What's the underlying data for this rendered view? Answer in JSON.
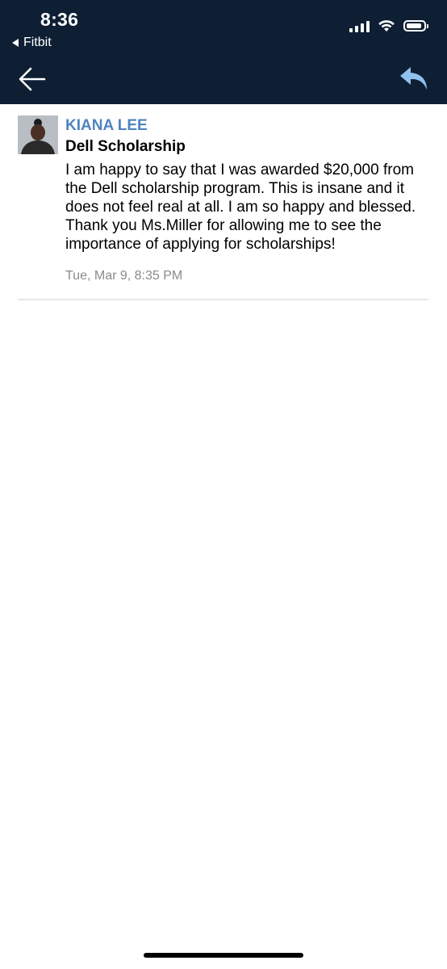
{
  "status_bar": {
    "time": "8:36",
    "back_app": "Fitbit",
    "icons": [
      "cellular-signal-icon",
      "wifi-icon",
      "battery-icon"
    ]
  },
  "nav": {
    "back_icon": "arrow-left-icon",
    "reply_icon": "reply-icon"
  },
  "message": {
    "sender": "KIANA LEE",
    "subject": "Dell Scholarship",
    "body": "I am happy to say that I was awarded $20,000 from the Dell scholarship program. This is insane and it does not feel real at all. I am so happy and blessed. Thank you Ms.Miller for allowing me to see the importance of applying for scholarships!",
    "timestamp": "Tue, Mar 9, 8:35 PM"
  },
  "colors": {
    "header_bg": "#0e1f34",
    "sender_blue": "#4f83bf",
    "reply_icon_blue": "#8fc1ef",
    "timestamp_gray": "#8a8a8a",
    "divider": "#e6e6e6"
  }
}
